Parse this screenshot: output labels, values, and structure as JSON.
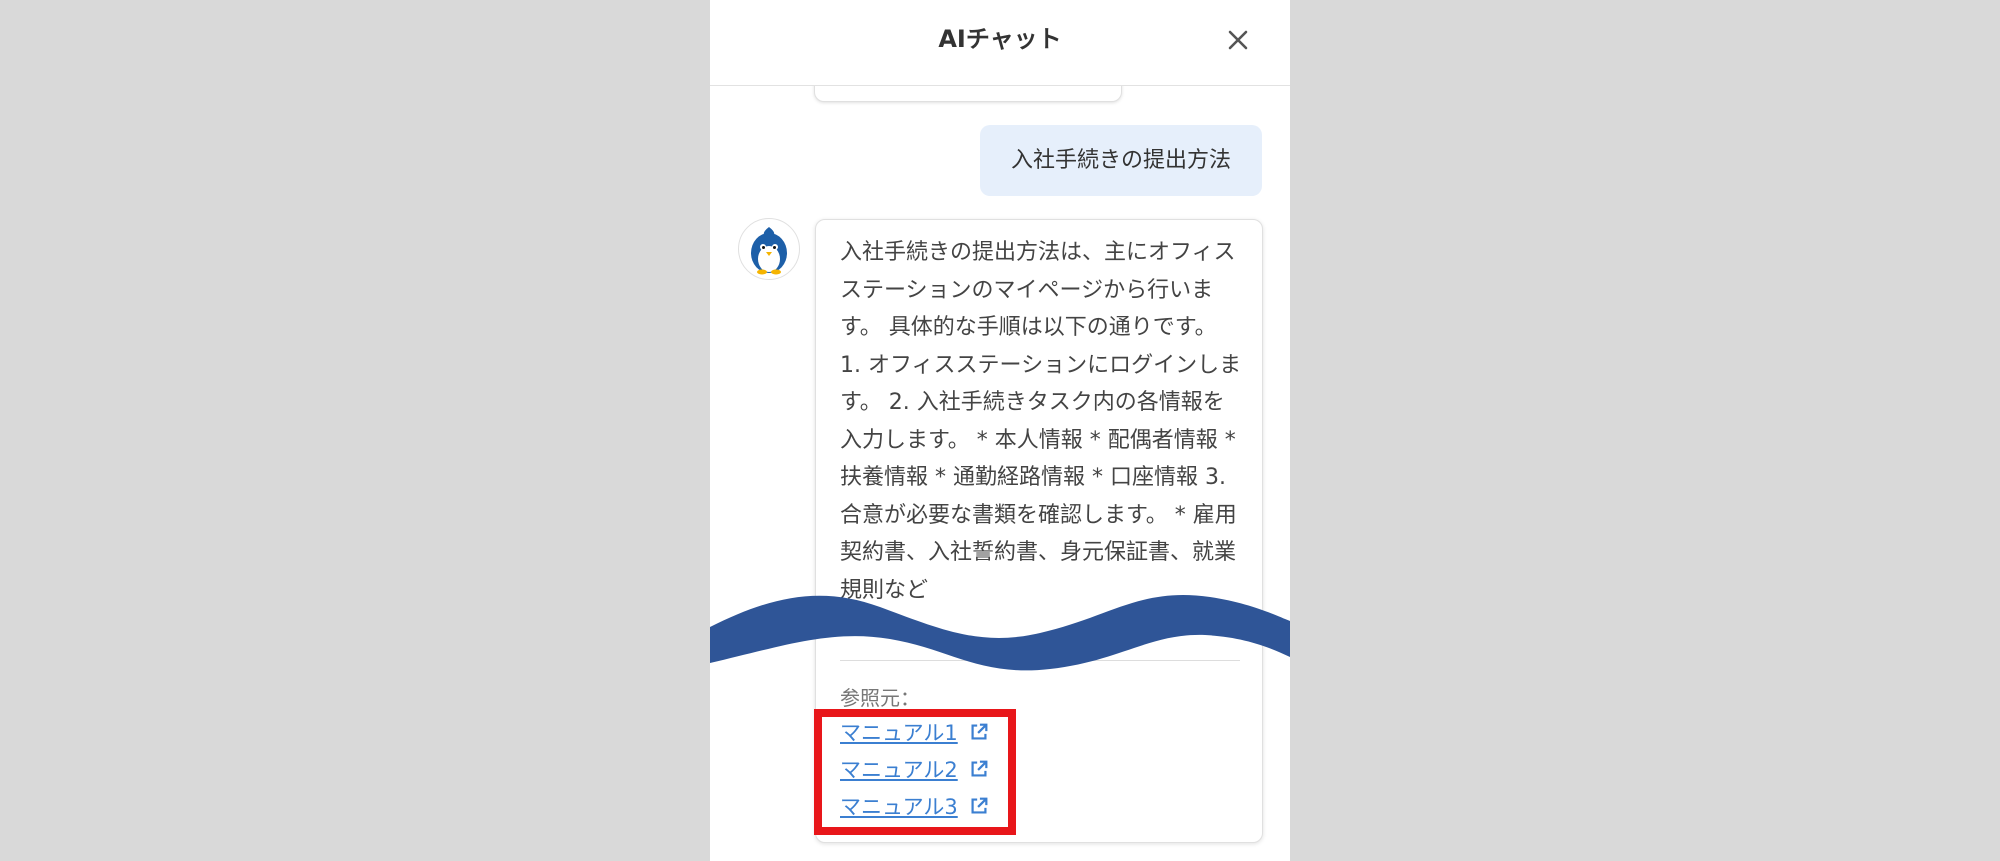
{
  "header": {
    "title": "AIチャット"
  },
  "user_message": "入社手続きの提出方法",
  "bot_message": "入社手続きの提出方法は、主にオフィスステーションのマイページから行います。 具体的な手順は以下の通りです。 1. オフィスステーションにログインします。 2. 入社手続きタスク内の各情報を入力します。 * 本人情報 * 配偶者情報 * 扶養情報 * 通勤経路情報 * 口座情報 3. 合意が必要な書類を確認します。 * 雇用契約書、入社誓約書、身元保証書、就業規則など",
  "references": {
    "label": "参照元：",
    "links": [
      "マニュアル1",
      "マニュアル2",
      "マニュアル3"
    ]
  },
  "colors": {
    "highlight": "#e8161a",
    "wave": "#2f5597",
    "link": "#3b7fd1",
    "user_bubble": "#e6effb"
  }
}
